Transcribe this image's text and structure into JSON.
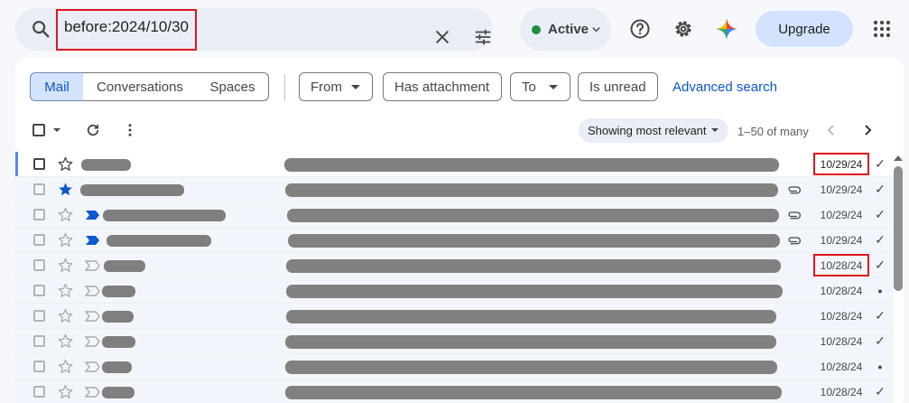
{
  "search": {
    "query": "before:2024/10/30"
  },
  "status": {
    "label": "Active",
    "color": "#1e8e3e"
  },
  "header": {
    "upgrade_label": "Upgrade"
  },
  "view_tabs": [
    "Mail",
    "Conversations",
    "Spaces"
  ],
  "filters": {
    "from": "From",
    "attachment": "Has attachment",
    "to": "To",
    "unread": "Is unread",
    "advanced": "Advanced search"
  },
  "toolbar": {
    "sort_label": "Showing most relevant",
    "range": "1–50 of many"
  },
  "colors": {
    "accent": "#0b57d0",
    "highlight": "#e0141e",
    "redacted": "#808080"
  },
  "emails": [
    {
      "date": "10/29/24",
      "mark": "✓",
      "starred": false,
      "important": "none",
      "attachment": false,
      "unread": true
    },
    {
      "date": "10/29/24",
      "mark": "✓",
      "starred": true,
      "important": "none",
      "attachment": true,
      "unread": false
    },
    {
      "date": "10/29/24",
      "mark": "✓",
      "starred": false,
      "important": "filled",
      "attachment": true,
      "unread": false
    },
    {
      "date": "10/29/24",
      "mark": "✓",
      "starred": false,
      "important": "filled",
      "attachment": true,
      "unread": false
    },
    {
      "date": "10/28/24",
      "mark": "✓",
      "starred": false,
      "important": "outline",
      "attachment": false,
      "unread": false
    },
    {
      "date": "10/28/24",
      "mark": "●",
      "starred": false,
      "important": "outline",
      "attachment": false,
      "unread": false
    },
    {
      "date": "10/28/24",
      "mark": "✓",
      "starred": false,
      "important": "outline",
      "attachment": false,
      "unread": false
    },
    {
      "date": "10/28/24",
      "mark": "✓",
      "starred": false,
      "important": "outline",
      "attachment": false,
      "unread": false
    },
    {
      "date": "10/28/24",
      "mark": "●",
      "starred": false,
      "important": "outline",
      "attachment": false,
      "unread": false
    },
    {
      "date": "10/28/24",
      "mark": "✓",
      "starred": false,
      "important": "outline",
      "attachment": false,
      "unread": false
    }
  ]
}
